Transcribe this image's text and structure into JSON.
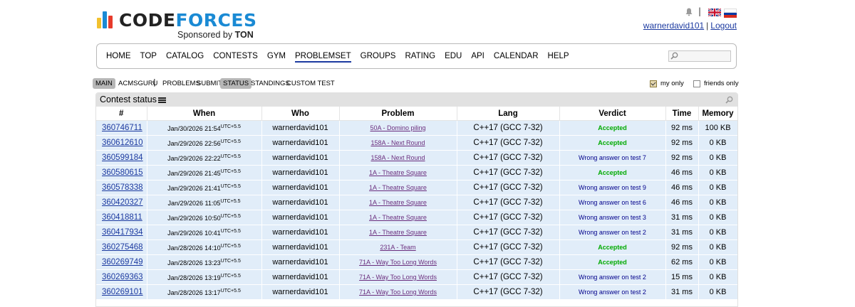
{
  "logo": {
    "word1": "CODE",
    "word2": "FORCES",
    "sponsor_prefix": "Sponsored by",
    "sponsor_name": "TON"
  },
  "header": {
    "username": "warnerdavid101",
    "separator": "|",
    "logout_label": "Logout",
    "icons": [
      "bell-icon",
      "uk-flag-icon",
      "ru-flag-icon"
    ]
  },
  "menu": {
    "items": [
      "HOME",
      "TOP",
      "CATALOG",
      "CONTESTS",
      "GYM",
      "PROBLEMSET",
      "GROUPS",
      "RATING",
      "EDU",
      "API",
      "CALENDAR",
      "HELP"
    ],
    "active": "PROBLEMSET"
  },
  "submenu": {
    "main": "MAIN",
    "acmsguru": "ACMSGURU",
    "sep": "|",
    "problems": "PROBLEMS",
    "submit": "SUBMIT",
    "status": "STATUS",
    "standings": "STANDINGS",
    "custom_test": "CUSTOM TEST",
    "my_only": "my only",
    "friends_only": "friends only",
    "my_only_checked": true,
    "friends_only_checked": false
  },
  "panel": {
    "title": "Contest status"
  },
  "table": {
    "headers": [
      "#",
      "When",
      "Who",
      "Problem",
      "Lang",
      "Verdict",
      "Time",
      "Memory"
    ],
    "rows": [
      {
        "id": "360746711",
        "when": "Jan/30/2026 21:54",
        "tz": "UTC+5.5",
        "who": "warnerdavid101",
        "problem": "50A - Domino piling",
        "lang": "C++17 (GCC 7-32)",
        "verdict": "Accepted",
        "accepted": true,
        "time": "92 ms",
        "memory": "100 KB"
      },
      {
        "id": "360612610",
        "when": "Jan/29/2026 22:56",
        "tz": "UTC+5.5",
        "who": "warnerdavid101",
        "problem": "158A - Next Round",
        "lang": "C++17 (GCC 7-32)",
        "verdict": "Accepted",
        "accepted": true,
        "time": "92 ms",
        "memory": "0 KB"
      },
      {
        "id": "360599184",
        "when": "Jan/29/2026 22:22",
        "tz": "UTC+5.5",
        "who": "warnerdavid101",
        "problem": "158A - Next Round",
        "lang": "C++17 (GCC 7-32)",
        "verdict": "Wrong answer on test 7",
        "accepted": false,
        "time": "92 ms",
        "memory": "0 KB"
      },
      {
        "id": "360580615",
        "when": "Jan/29/2026 21:45",
        "tz": "UTC+5.5",
        "who": "warnerdavid101",
        "problem": "1A - Theatre Square",
        "lang": "C++17 (GCC 7-32)",
        "verdict": "Accepted",
        "accepted": true,
        "time": "46 ms",
        "memory": "0 KB"
      },
      {
        "id": "360578338",
        "when": "Jan/29/2026 21:41",
        "tz": "UTC+5.5",
        "who": "warnerdavid101",
        "problem": "1A - Theatre Square",
        "lang": "C++17 (GCC 7-32)",
        "verdict": "Wrong answer on test 9",
        "accepted": false,
        "time": "46 ms",
        "memory": "0 KB"
      },
      {
        "id": "360420327",
        "when": "Jan/29/2026 11:05",
        "tz": "UTC+5.5",
        "who": "warnerdavid101",
        "problem": "1A - Theatre Square",
        "lang": "C++17 (GCC 7-32)",
        "verdict": "Wrong answer on test 6",
        "accepted": false,
        "time": "46 ms",
        "memory": "0 KB"
      },
      {
        "id": "360418811",
        "when": "Jan/29/2026 10:50",
        "tz": "UTC+5.5",
        "who": "warnerdavid101",
        "problem": "1A - Theatre Square",
        "lang": "C++17 (GCC 7-32)",
        "verdict": "Wrong answer on test 3",
        "accepted": false,
        "time": "31 ms",
        "memory": "0 KB"
      },
      {
        "id": "360417934",
        "when": "Jan/29/2026 10:41",
        "tz": "UTC+5.5",
        "who": "warnerdavid101",
        "problem": "1A - Theatre Square",
        "lang": "C++17 (GCC 7-32)",
        "verdict": "Wrong answer on test 2",
        "accepted": false,
        "time": "31 ms",
        "memory": "0 KB"
      },
      {
        "id": "360275468",
        "when": "Jan/28/2026 14:10",
        "tz": "UTC+5.5",
        "who": "warnerdavid101",
        "problem": "231A - Team",
        "lang": "C++17 (GCC 7-32)",
        "verdict": "Accepted",
        "accepted": true,
        "time": "92 ms",
        "memory": "0 KB"
      },
      {
        "id": "360269749",
        "when": "Jan/28/2026 13:23",
        "tz": "UTC+5.5",
        "who": "warnerdavid101",
        "problem": "71A - Way Too Long Words",
        "lang": "C++17 (GCC 7-32)",
        "verdict": "Accepted",
        "accepted": true,
        "time": "62 ms",
        "memory": "0 KB"
      },
      {
        "id": "360269363",
        "when": "Jan/28/2026 13:19",
        "tz": "UTC+5.5",
        "who": "warnerdavid101",
        "problem": "71A - Way Too Long Words",
        "lang": "C++17 (GCC 7-32)",
        "verdict": "Wrong answer on test 2",
        "accepted": false,
        "time": "15 ms",
        "memory": "0 KB"
      },
      {
        "id": "360269101",
        "when": "Jan/28/2026 13:17",
        "tz": "UTC+5.5",
        "who": "warnerdavid101",
        "problem": "71A - Way Too Long Words",
        "lang": "C++17 (GCC 7-32)",
        "verdict": "Wrong answer on test 2",
        "accepted": false,
        "time": "31 ms",
        "memory": "0 KB"
      }
    ]
  },
  "colors": {
    "link": "#1c3aa0",
    "problem_link": "#6b2e7e",
    "accepted": "#00aa00",
    "wrong_answer": "#00008b",
    "row_bg": "#e1edf9",
    "panel_header": "#e1e1e1"
  }
}
